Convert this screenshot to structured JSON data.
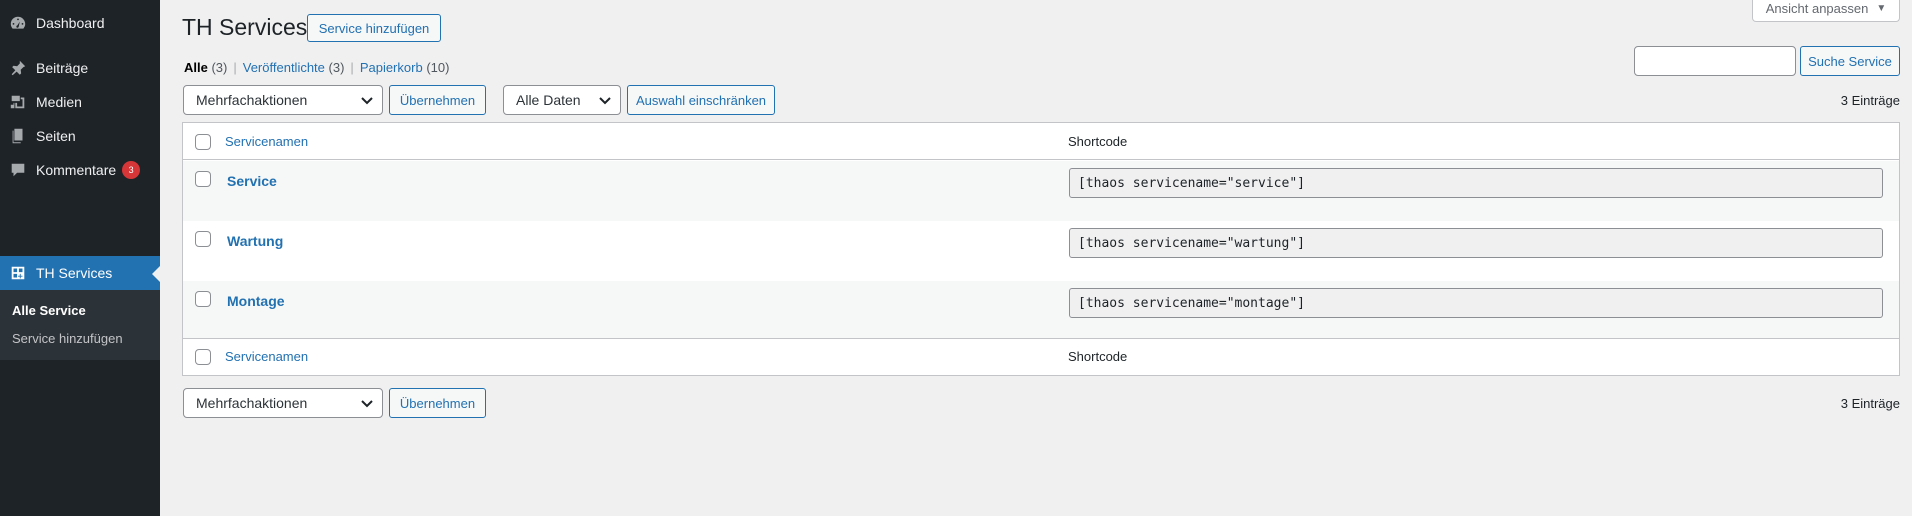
{
  "sidebar": {
    "items": [
      {
        "label": "Dashboard"
      },
      {
        "label": "Beiträge"
      },
      {
        "label": "Medien"
      },
      {
        "label": "Seiten"
      },
      {
        "label": "Kommentare",
        "badge": "3"
      },
      {
        "label": "TH Services"
      }
    ],
    "submenu": [
      {
        "label": "Alle Service"
      },
      {
        "label": "Service hinzufügen"
      }
    ]
  },
  "header": {
    "title": "TH Services",
    "add_button": "Service hinzufügen",
    "screen_options": "Ansicht anpassen"
  },
  "views": {
    "all_label": "Alle",
    "all_count": "(3)",
    "published_label": "Veröffentlichte",
    "published_count": "(3)",
    "trash_label": "Papierkorb",
    "trash_count": "(10)"
  },
  "search": {
    "value": "",
    "button": "Suche Service"
  },
  "toolbar": {
    "bulk_actions": "Mehrfachaktionen",
    "apply": "Übernehmen",
    "dates": "Alle Daten",
    "filter": "Auswahl einschränken",
    "entries": "3 Einträge"
  },
  "table": {
    "col_name": "Servicenamen",
    "col_shortcode": "Shortcode",
    "rows": [
      {
        "name": "Service",
        "shortcode": "[thaos servicename=\"service\"]"
      },
      {
        "name": "Wartung",
        "shortcode": "[thaos servicename=\"wartung\"]"
      },
      {
        "name": "Montage",
        "shortcode": "[thaos servicename=\"montage\"]"
      }
    ]
  },
  "colors": {
    "sidebar_bg": "#1d2327",
    "accent": "#2271b1",
    "badge": "#d63638",
    "page_bg": "#f0f0f1"
  }
}
